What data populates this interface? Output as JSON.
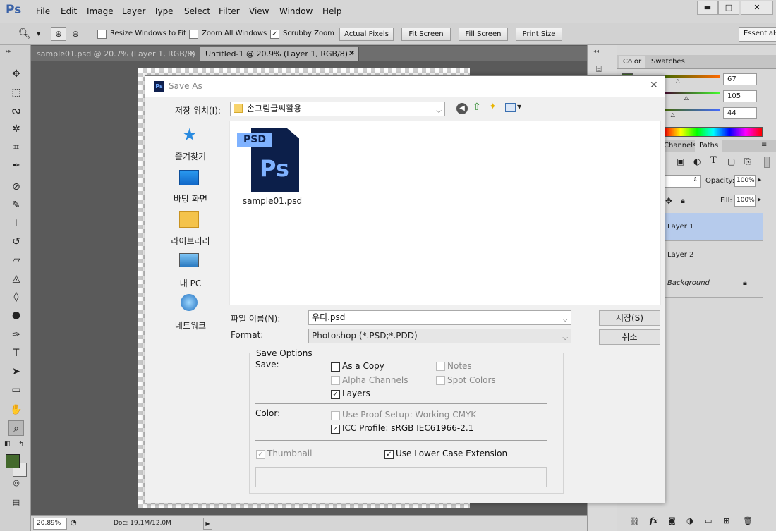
{
  "app": {
    "logo": "Ps"
  },
  "menu": [
    "File",
    "Edit",
    "Image",
    "Layer",
    "Type",
    "Select",
    "Filter",
    "View",
    "Window",
    "Help"
  ],
  "window_controls": {
    "minimize": "▬",
    "maximize": "□",
    "close": "✕"
  },
  "options": {
    "resize": "Resize Windows to Fit",
    "zoom_all": "Zoom All Windows",
    "scrubby": "Scrubby Zoom",
    "actual": "Actual Pixels",
    "fit": "Fit Screen",
    "fill": "Fill Screen",
    "print": "Print Size",
    "workspace": "Essentials"
  },
  "tabs": [
    {
      "label": "sample01.psd @ 20.7% (Layer 1, RGB/8)",
      "close": "✕"
    },
    {
      "label": "Untitled-1 @ 20.9% (Layer 1, RGB/8) *",
      "close": "✕"
    }
  ],
  "status": {
    "zoom": "20.89%",
    "doc": "Doc: 19.1M/12.0M"
  },
  "color_panel": {
    "tabs": [
      "Color",
      "Swatches"
    ],
    "r": "67",
    "g": "105",
    "b": "44",
    "fg": "#43692c",
    "r_level": 0.26,
    "g_level": 0.41,
    "b_level": 0.17
  },
  "layers_panel": {
    "tabs": [
      "Channels",
      "Paths"
    ],
    "opacity_label": "Opacity:",
    "opacity": "100%",
    "fill_label": "Fill:",
    "fill": "100%",
    "layers": [
      "Layer 1",
      "Layer 2",
      "Background"
    ]
  },
  "dialog": {
    "title": "Save As",
    "location_label": "저장 위치(I):",
    "location": "손그림글씨활용",
    "places": [
      "즐겨찾기",
      "바탕 화면",
      "라이브러리",
      "내 PC",
      "네트워크"
    ],
    "file": {
      "name": "sample01.psd",
      "badge": "PSD",
      "icon_text": "Ps"
    },
    "filename_label": "파일 이름(N):",
    "filename": "우디.psd",
    "format_label": "Format:",
    "format": "Photoshop (*.PSD;*.PDD)",
    "save_btn": "저장(S)",
    "cancel_btn": "취소",
    "save_options_title": "Save Options",
    "save_label": "Save:",
    "as_copy": "As a Copy",
    "notes": "Notes",
    "alpha": "Alpha Channels",
    "spot": "Spot Colors",
    "layers": "Layers",
    "color_label": "Color:",
    "proof": "Use Proof Setup:  Working CMYK",
    "icc": "ICC Profile:  sRGB IEC61966-2.1",
    "thumbnail": "Thumbnail",
    "lowercase": "Use Lower Case Extension",
    "check": "✓"
  }
}
